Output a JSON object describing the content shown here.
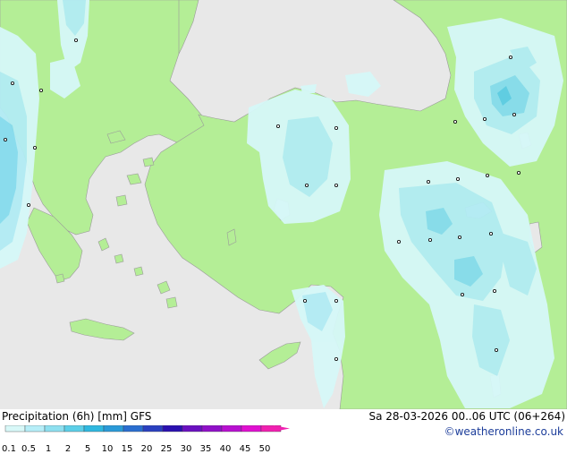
{
  "footer": {
    "title": "Precipitation (6h) [mm] GFS",
    "datetime": "Sa 28-03-2026 00..06 UTC (06+264)",
    "copyright": "©weatheronline.co.uk"
  },
  "legend": {
    "labels": [
      "0.1",
      "0.5",
      "1",
      "2",
      "5",
      "10",
      "15",
      "20",
      "25",
      "30",
      "35",
      "40",
      "45",
      "50"
    ],
    "colors": [
      "#d8f8f8",
      "#b6eef8",
      "#8ee0f0",
      "#5ccfe8",
      "#2fb8e0",
      "#2a9ad8",
      "#2a6ed0",
      "#2a40c0",
      "#2a10b0",
      "#6a10c0",
      "#9010c8",
      "#b810d0",
      "#e010d0",
      "#f020b0"
    ]
  },
  "map": {
    "colors": {
      "sea": "#e8e8e8",
      "land": "#b4ee96",
      "coast": "#9a9a9a",
      "precip_light": "#d6f8f8",
      "precip_mid": "#b2ecf4",
      "precip_heavy": "#86dcee",
      "precip_max": "#5ccce6"
    }
  }
}
